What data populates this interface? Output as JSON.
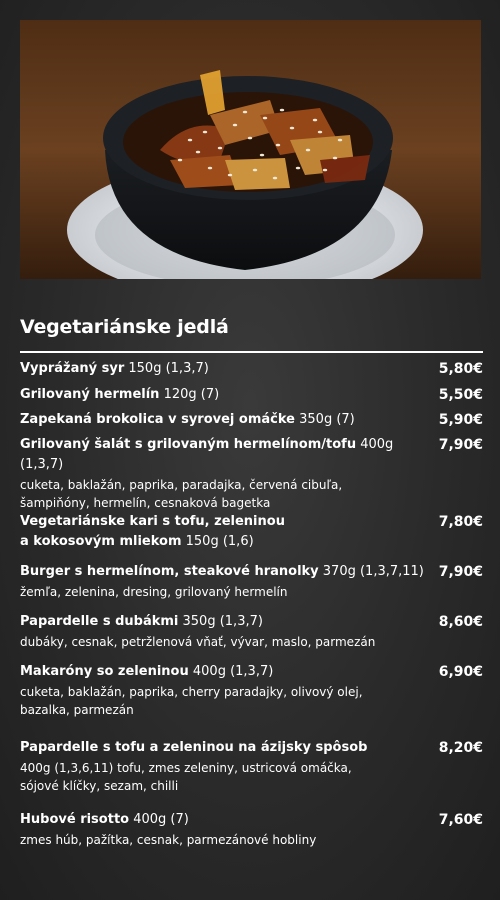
{
  "section": {
    "title": "Vegetariánske jedlá"
  },
  "items": [
    {
      "name": "Vyprážaný syr",
      "meta": "150g (1,3,7)",
      "price": "5,80€"
    },
    {
      "name": "Grilovaný hermelín",
      "meta": "120g (7)",
      "price": "5,50€"
    },
    {
      "name": "Zapekaná brokolica v syrovej omáčke",
      "meta": "350g (7)",
      "price": "5,90€"
    },
    {
      "name": "Grilovaný šalát s grilovaným hermelínom/tofu",
      "meta": "400g (1,3,7)",
      "desc": "cuketa, baklažán, paprika, paradajka, červená cibuľa, šampiňóny, hermelín, cesnaková bagetka",
      "price": "7,90€"
    },
    {
      "name_line1": "Vegetariánske kari s tofu, zeleninou",
      "name_line2": "a kokosovým mliekom",
      "meta": "150g (1,6)",
      "price": "7,80€"
    },
    {
      "name": "Burger s hermelínom, steakové hranolky",
      "meta": "370g (1,3,7,11)",
      "desc": "žemľa, zelenina, dresing, grilovaný hermelín",
      "price": "7,90€"
    },
    {
      "name": "Papardelle s dubákmi",
      "meta": "350g (1,3,7)",
      "desc": "dubáky, cesnak, petržlenová vňať, vývar, maslo, parmezán",
      "price": "8,60€"
    },
    {
      "name": "Makaróny so zeleninou",
      "meta": "400g (1,3,7)",
      "desc": "cuketa, baklažán, paprika, cherry paradajky, olivový olej, bazalka, parmezán",
      "price": "6,90€"
    },
    {
      "name": "Papardelle s tofu a zeleninou na ázijsky spôsob",
      "desc": "400g (1,3,6,11) tofu, zmes zeleniny, ustricová omáčka, sójové klíčky, sezam, chilli",
      "price": "8,20€"
    },
    {
      "name": "Hubové risotto",
      "meta": "400g (7)",
      "desc": "zmes húb, pažítka, cesnak, parmezánové hobliny",
      "price": "7,60€"
    }
  ]
}
